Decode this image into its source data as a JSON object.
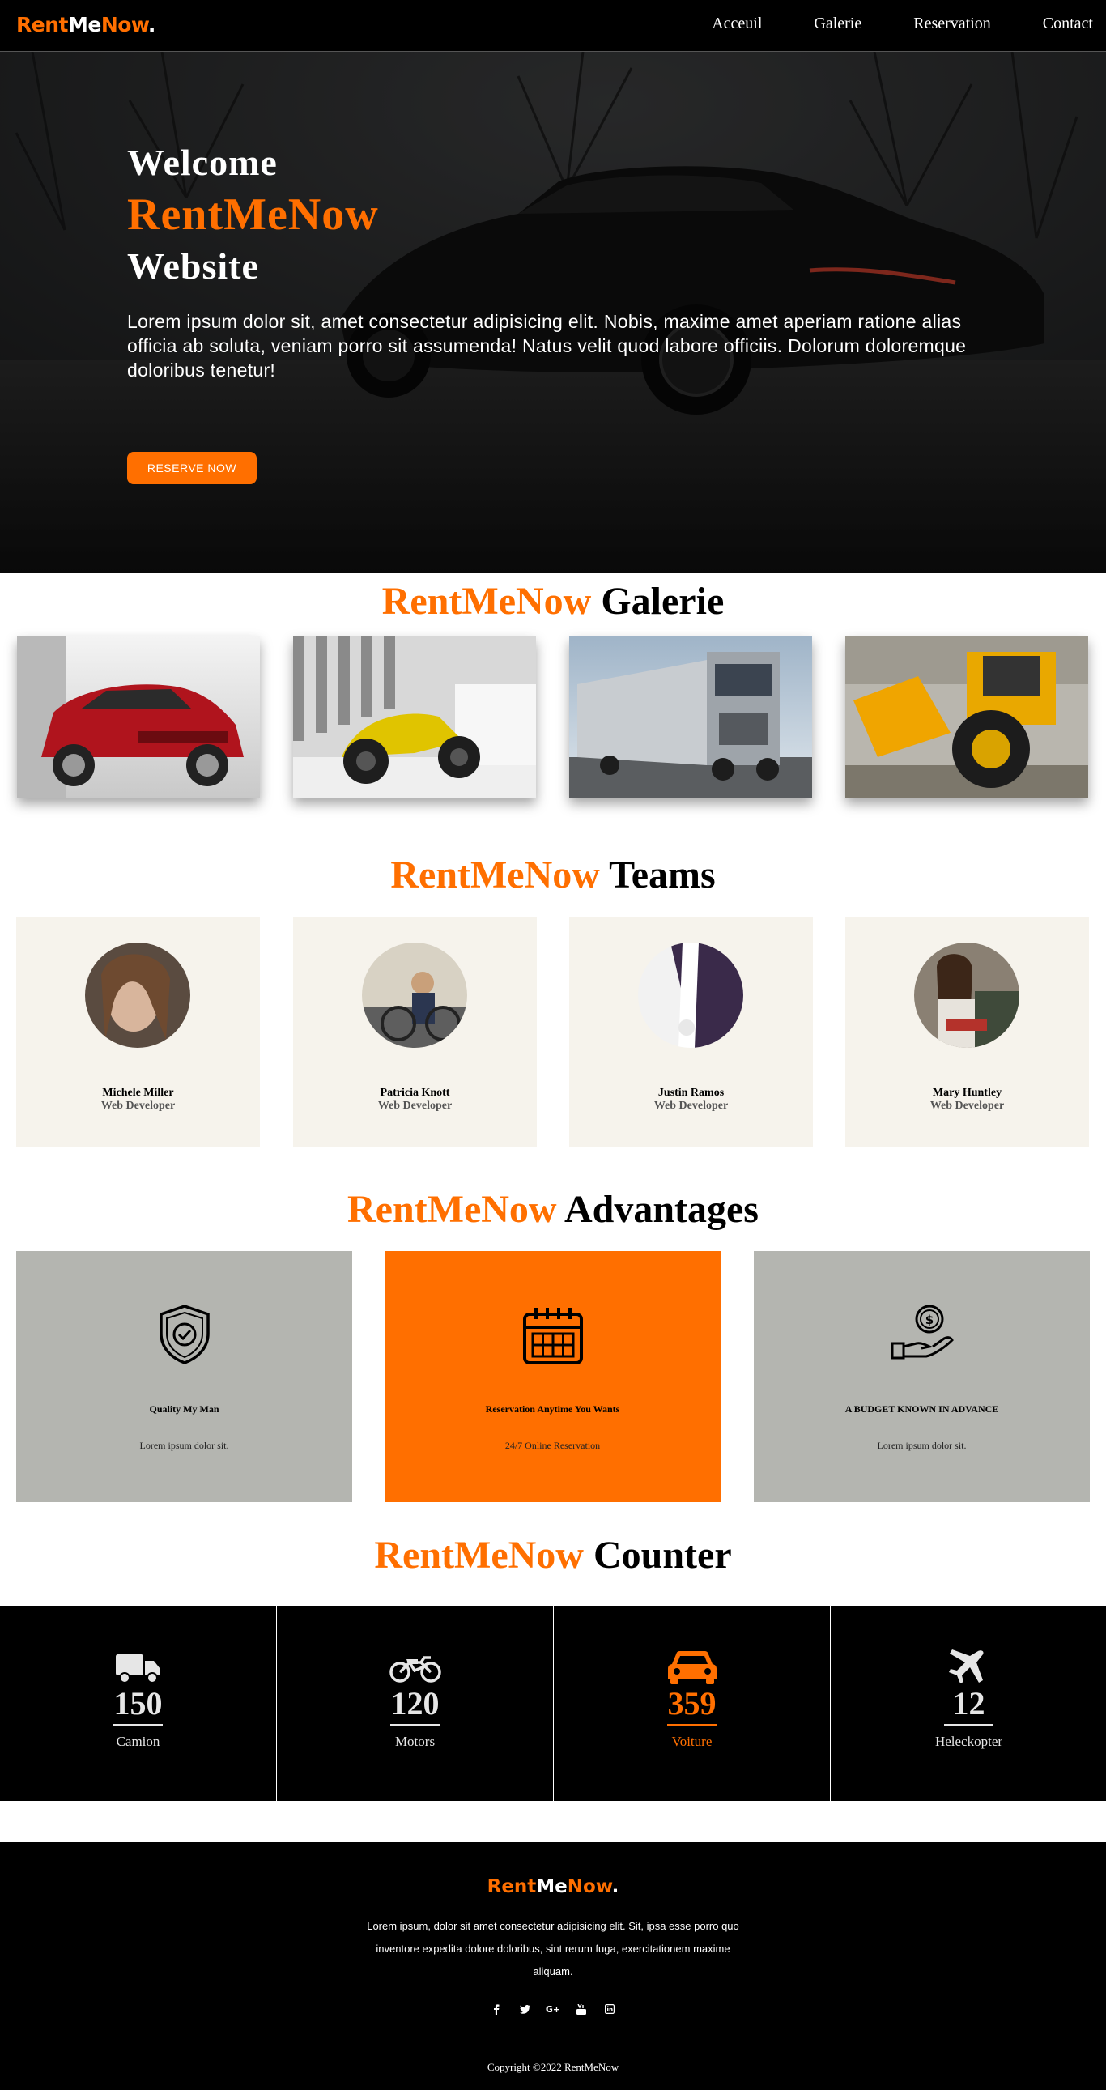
{
  "brand": {
    "part1": "Rent",
    "part2": "Me",
    "part3": "Now",
    "dot": "."
  },
  "nav": {
    "items": [
      "Acceuil",
      "Galerie",
      "Reservation",
      "Contact"
    ]
  },
  "hero": {
    "line1": "Welcome",
    "line2": "RentMeNow",
    "line3": "Website",
    "paragraph_line1": "Lorem ipsum dolor sit, amet consectetur adipisicing elit. Nobis, maxime amet aperiam ratione alias",
    "paragraph_line2": "officia ab soluta, veniam porro sit assumenda! Natus velit quod labore officiis. Dolorum doloremque",
    "paragraph_line3": "doloribus tenetur!",
    "button": "RESERVE NOW"
  },
  "galerie": {
    "title_brand": "RentMeNow",
    "title": "Galerie",
    "images": [
      "red-suv",
      "yellow-motorcycle",
      "silver-truck",
      "yellow-wheel-loader"
    ]
  },
  "teams": {
    "title_brand": "RentMeNow",
    "title": "Teams",
    "members": [
      {
        "name": "Michele Miller",
        "role": "Web Developer"
      },
      {
        "name": "Patricia Knott",
        "role": "Web Developer"
      },
      {
        "name": "Justin Ramos",
        "role": "Web Developer"
      },
      {
        "name": "Mary Huntley",
        "role": "Web Developer"
      }
    ]
  },
  "advantages": {
    "title_brand": "RentMeNow",
    "title": "Advantages",
    "items": [
      {
        "icon": "shield-check-icon",
        "title": "Quality My Man",
        "desc": "Lorem ipsum dolor sit."
      },
      {
        "icon": "calendar-icon",
        "title": "Reservation Anytime You Wants",
        "desc": "24/7 Online Reservation"
      },
      {
        "icon": "hand-coin-icon",
        "title": "A BUDGET KNOWN IN ADVANCE",
        "desc": "Lorem ipsum dolor sit."
      }
    ]
  },
  "counter": {
    "title_brand": "RentMeNow",
    "title": "Counter",
    "items": [
      {
        "icon": "truck-icon",
        "value": "150",
        "label": "Camion"
      },
      {
        "icon": "motorcycle-icon",
        "value": "120",
        "label": "Motors"
      },
      {
        "icon": "car-icon",
        "value": "359",
        "label": "Voiture"
      },
      {
        "icon": "plane-icon",
        "value": "12",
        "label": "Heleckopter"
      }
    ]
  },
  "footer": {
    "text_line1": "Lorem ipsum, dolor sit amet consectetur adipisicing elit. Sit, ipsa esse porro quo",
    "text_line2": "inventore expedita dolore doloribus, sint rerum fuga, exercitationem maxime",
    "text_line3": "aliquam.",
    "social": [
      "f",
      "t",
      "G+",
      "yt",
      "in"
    ],
    "copyright": "Copyright  ©2022  RentMeNow"
  },
  "colors": {
    "accent": "#ff6f00",
    "nav_bg": "#000000",
    "team_card": "#f6f3ec",
    "adv_card": "#b4b5b0"
  }
}
